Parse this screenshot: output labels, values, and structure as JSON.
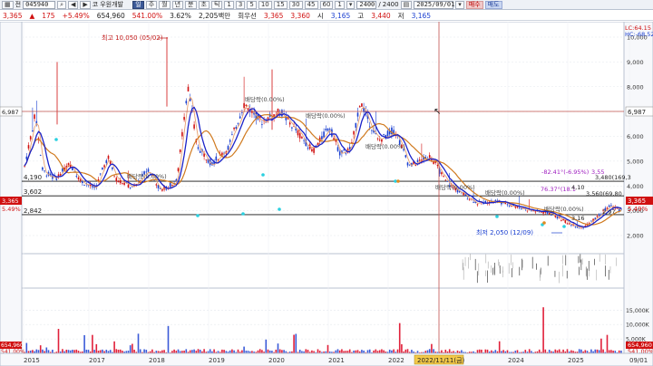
{
  "toolbar": {
    "menu_icon": "grid-menu-icon",
    "jeon_label": "전",
    "code": "045940",
    "search_icon": "search-icon",
    "prev_label": "◀",
    "next_label": "▶",
    "ko_label": "코",
    "name": "우원개발",
    "periods": [
      "일",
      "주",
      "월",
      "년",
      "분",
      "초",
      "틱"
    ],
    "numbers": [
      "1",
      "3",
      "5",
      "10",
      "15",
      "30",
      "45",
      "60",
      "1"
    ],
    "count": "2400",
    "count_total": "2400",
    "date": "2025/09/01",
    "buy_label": "매수",
    "sell_label": "매도"
  },
  "infobar": {
    "price": "3,365",
    "change": "175",
    "change_pct": "+5.49%",
    "volume": "654,960",
    "vol_pct": "541.00%",
    "turnover": "3.62%",
    "amount": "2,205백만",
    "rotation_label": "회우선",
    "pref_a": "3,365",
    "pref_b": "3,360",
    "open_label": "시",
    "open": "3,165",
    "high_label": "고",
    "high": "3,440",
    "low_label": "저",
    "low": "3,165"
  },
  "colors": {
    "up": "#d01010",
    "down": "#1a3fd0",
    "ma5": "#e8a070",
    "ma20": "#1a22c8",
    "ma60": "#d07a1f",
    "cursor": "#c0504d",
    "volume_up": "#e0203a",
    "volume_down": "#3a5ad8"
  },
  "price_axis": {
    "ticks": [
      "10,000",
      "9,000",
      "8,000",
      "7,000",
      "6,000",
      "5,000",
      "4,000",
      "3,000",
      "2,000"
    ],
    "cursor_value": "6,987",
    "current_value": "3,365",
    "current_pct": "5.49%"
  },
  "volume_axis": {
    "ticks": [
      "15,000K",
      "10,000K",
      "5,000K"
    ],
    "value": "654,960",
    "value_pct": "541.00%"
  },
  "left_axis": {
    "cursor_value": "6,987",
    "current_value": "3,365",
    "current_pct": "5.49%",
    "vol_value": "654,960",
    "vol_pct": "541.00%"
  },
  "time_axis": {
    "labels": [
      "2015",
      "2017",
      "2018",
      "2019",
      "2020",
      "2021",
      "2022",
      "2024",
      "2025",
      "09/01"
    ],
    "cursor_label": "2022/11/11(금)"
  },
  "legend": {
    "lc": "LC:64.15",
    "hc": "HC:-68.52"
  },
  "annotations": {
    "max": "최고 10,050 (05/02)",
    "min": "최저 2,050 (12/09)",
    "dividend": "배당락(0.00%)",
    "level_4190": "4,190",
    "level_3602": "3,602",
    "level_2842": "2,842",
    "r1": "-82.41°(-6.95%)",
    "r1b": "3,55",
    "r2": "3,480(169,3",
    "r3": "76.37°(18.1",
    "r4": "3,560(69,80",
    "r5": "4,10",
    "r6": "3,16",
    "r7": "2,97"
  }
}
